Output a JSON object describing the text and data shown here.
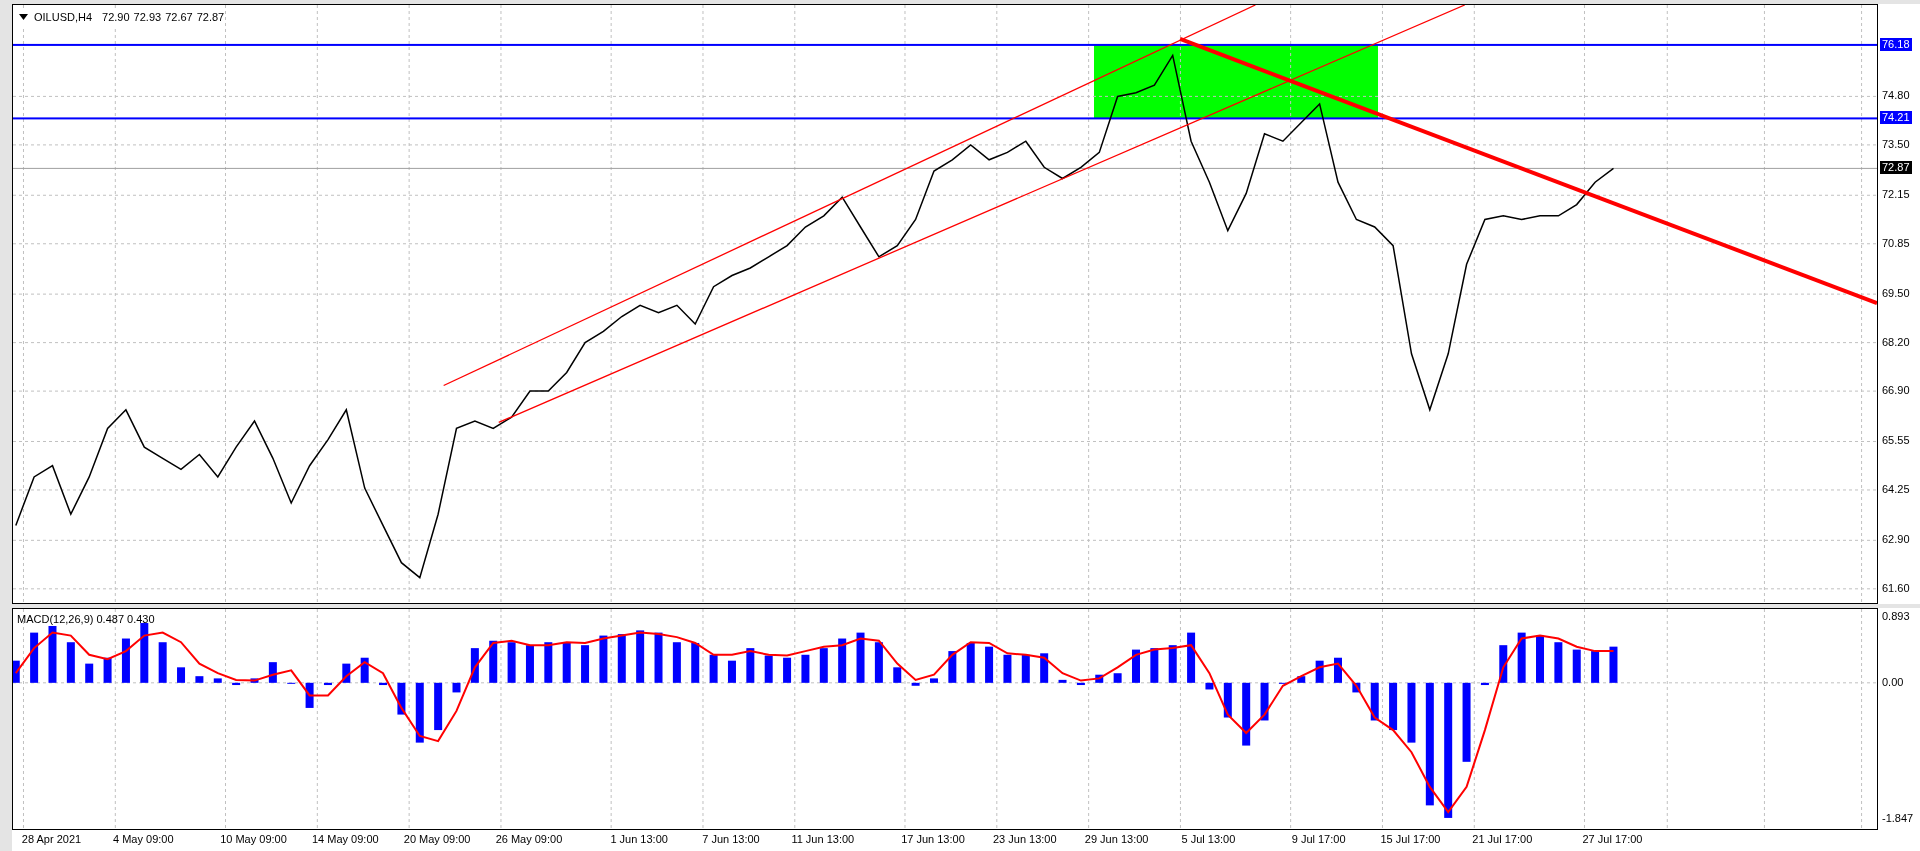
{
  "header": {
    "symbol": "OILUSD,H4",
    "ohlc": [
      "72.90",
      "72.93",
      "72.67",
      "72.87"
    ]
  },
  "price_chart": {
    "chart_data": {
      "type": "line",
      "grid": true,
      "ylim": [
        61.22,
        77.25
      ],
      "yticks": [
        {
          "value": 61.6,
          "label": "61.60"
        },
        {
          "value": 62.9,
          "label": "62.90"
        },
        {
          "value": 64.25,
          "label": "64.25"
        },
        {
          "value": 65.55,
          "label": "65.55"
        },
        {
          "value": 66.9,
          "label": "66.90"
        },
        {
          "value": 68.2,
          "label": "68.20"
        },
        {
          "value": 69.5,
          "label": "69.50"
        },
        {
          "value": 70.85,
          "label": "70.85"
        },
        {
          "value": 72.15,
          "label": "72.15"
        },
        {
          "value": 73.5,
          "label": "73.50"
        },
        {
          "value": 74.8,
          "label": "74.80"
        }
      ],
      "series": [
        {
          "color": "#000000",
          "values": [
            63.3,
            64.6,
            64.9,
            63.6,
            64.6,
            65.9,
            66.4,
            65.4,
            65.1,
            64.8,
            65.2,
            64.6,
            65.4,
            66.1,
            65.1,
            63.9,
            64.9,
            65.6,
            66.4,
            64.3,
            63.3,
            62.3,
            61.9,
            63.6,
            65.9,
            66.1,
            65.9,
            66.2,
            66.9,
            66.9,
            67.4,
            68.2,
            68.5,
            68.9,
            69.2,
            69.0,
            69.2,
            68.7,
            69.7,
            70.0,
            70.2,
            70.5,
            70.8,
            71.3,
            71.6,
            72.1,
            71.3,
            70.5,
            70.8,
            71.5,
            72.8,
            73.1,
            73.5,
            73.1,
            73.3,
            73.6,
            72.9,
            72.6,
            72.9,
            73.3,
            74.8,
            74.9,
            75.1,
            75.9,
            73.6,
            72.5,
            71.2,
            72.2,
            73.8,
            73.6,
            74.1,
            74.6,
            72.5,
            71.5,
            71.3,
            70.8,
            67.9,
            66.4,
            67.9,
            70.3,
            71.5,
            71.6,
            71.5,
            71.6,
            71.6,
            71.9,
            72.5,
            72.87
          ]
        }
      ],
      "ref_lines": [
        {
          "axis": "y",
          "value": 76.18,
          "label": "76.18",
          "color": "#0000ff"
        },
        {
          "axis": "y",
          "value": 74.21,
          "label": "74.21",
          "color": "#0000ff"
        },
        {
          "axis": "y",
          "value": 72.87,
          "label": "72.87",
          "color": "#a0a0a0"
        }
      ]
    }
  },
  "macd": {
    "label": "MACD(12,26,9) 0.487 0.430",
    "chart_data": {
      "type": "bar",
      "grid": true,
      "ylim": [
        -1.98,
        1.0
      ],
      "categories": [
        null,
        null,
        "28 Apr 2021",
        null,
        null,
        null,
        null,
        "4 May 09:00",
        null,
        null,
        null,
        null,
        null,
        "10 May 09:00",
        null,
        null,
        null,
        null,
        "14 May 09:00",
        null,
        null,
        null,
        null,
        "20 May 09:00",
        null,
        null,
        null,
        null,
        "26 May 09:00",
        null,
        null,
        null,
        null,
        null,
        "1 Jun 13:00",
        null,
        null,
        null,
        null,
        "7 Jun 13:00",
        null,
        null,
        null,
        null,
        "11 Jun 13:00",
        null,
        null,
        null,
        null,
        null,
        "17 Jun 13:00",
        null,
        null,
        null,
        null,
        "23 Jun 13:00",
        null,
        null,
        null,
        null,
        "29 Jun 13:00",
        null,
        null,
        null,
        null,
        "5 Jul 13:00",
        null,
        null,
        null,
        null,
        null,
        "9 Jul 17:00",
        null,
        null,
        null,
        null,
        "15 Jul 17:00",
        null,
        null,
        null,
        null,
        "21 Jul 17:00",
        null,
        null,
        null,
        null,
        null,
        "27 Jul 17:00"
      ],
      "yticks": [
        {
          "value": 0.893,
          "label": "0.893"
        },
        {
          "value": 0,
          "label": "0.00"
        },
        {
          "value": -1.847,
          "label": "-1.847"
        }
      ],
      "series": [
        {
          "type": "bar",
          "color": "#0000ff",
          "values": [
            0.3,
            0.68,
            0.77,
            0.55,
            0.26,
            0.34,
            0.6,
            0.81,
            0.55,
            0.21,
            0.09,
            0.06,
            -0.03,
            0.06,
            0.28,
            0,
            -0.34,
            -0.03,
            0.26,
            0.34,
            -0.03,
            -0.43,
            -0.81,
            -0.64,
            -0.13,
            0.47,
            0.57,
            0.55,
            0.51,
            0.55,
            0.54,
            0.51,
            0.64,
            0.66,
            0.71,
            0.68,
            0.55,
            0.54,
            0.38,
            0.3,
            0.47,
            0.37,
            0.34,
            0.38,
            0.47,
            0.6,
            0.68,
            0.55,
            0.21,
            -0.04,
            0.06,
            0.43,
            0.54,
            0.49,
            0.38,
            0.38,
            0.4,
            0.04,
            -0.03,
            0.11,
            0.13,
            0.45,
            0.47,
            0.51,
            0.68,
            -0.09,
            -0.47,
            -0.85,
            -0.51,
            0,
            0.09,
            0.3,
            0.34,
            -0.13,
            -0.51,
            -0.64,
            -0.81,
            -1.66,
            -1.83,
            -1.07,
            -0.03,
            0.51,
            0.68,
            0.64,
            0.55,
            0.45,
            0.43,
            0.49
          ]
        },
        {
          "type": "line",
          "color": "#ff0000",
          "values": [
            0.13,
            0.47,
            0.68,
            0.64,
            0.38,
            0.32,
            0.43,
            0.64,
            0.68,
            0.55,
            0.26,
            0.13,
            0.04,
            0.03,
            0.11,
            0.17,
            -0.17,
            -0.17,
            0.09,
            0.28,
            0.13,
            -0.34,
            -0.72,
            -0.79,
            -0.38,
            0.21,
            0.54,
            0.57,
            0.51,
            0.51,
            0.55,
            0.54,
            0.6,
            0.64,
            0.68,
            0.66,
            0.62,
            0.54,
            0.38,
            0.38,
            0.43,
            0.38,
            0.37,
            0.43,
            0.49,
            0.51,
            0.6,
            0.57,
            0.26,
            0.04,
            0.11,
            0.38,
            0.55,
            0.54,
            0.4,
            0.38,
            0.34,
            0.13,
            0.03,
            0.06,
            0.21,
            0.38,
            0.45,
            0.47,
            0.51,
            0.13,
            -0.43,
            -0.68,
            -0.43,
            -0.04,
            0.09,
            0.21,
            0.26,
            -0.04,
            -0.47,
            -0.64,
            -0.94,
            -1.41,
            -1.75,
            -1.41,
            -0.64,
            0.21,
            0.6,
            0.64,
            0.6,
            0.49,
            0.43,
            0.43
          ]
        }
      ]
    }
  }
}
